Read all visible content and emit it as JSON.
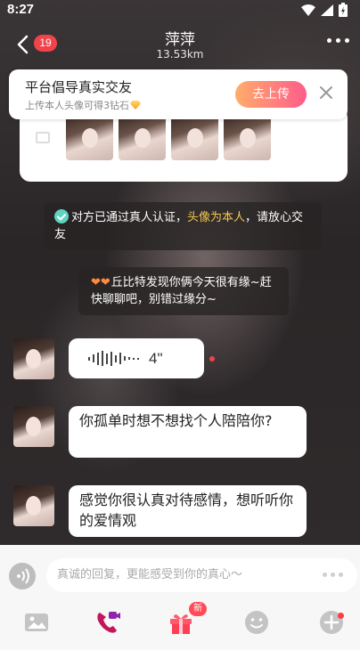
{
  "status": {
    "time": "8:27"
  },
  "header": {
    "unread_count": "19",
    "title": "萍萍",
    "distance": "13.53km"
  },
  "banner": {
    "title": "平台倡导真实交友",
    "subtitle": "上传本人头像可得3钻石",
    "button": "去上传"
  },
  "notices": [
    {
      "before": "对方已通过真人认证，",
      "highlight": "头像为本人",
      "after": "，请放心交友"
    },
    {
      "text": "丘比特发现你俩今天很有缘~赶快聊聊吧，别错过缘分~"
    }
  ],
  "messages": [
    {
      "type": "voice",
      "duration": "4\""
    },
    {
      "type": "text",
      "text": "你孤单时想不想找个人陪陪你?"
    },
    {
      "type": "text",
      "text": "感觉你很认真对待感情，想听听你的爱情观"
    }
  ],
  "input": {
    "placeholder": "真诚的回复，更能感受到你的真心～"
  },
  "toolbar": {
    "gift_badge": "新"
  },
  "colors": {
    "accent": "#f2434b",
    "highlight": "#f5c64c",
    "upload_gradient_start": "#ffad6b",
    "upload_gradient_end": "#ff5c8a"
  },
  "icons": [
    "back-arrow-icon",
    "more-icon",
    "close-icon",
    "gallery-icon",
    "verified-icon",
    "heart-icon",
    "voice-icon",
    "image-icon",
    "video-call-icon",
    "gift-icon",
    "emoji-icon",
    "plus-icon"
  ]
}
